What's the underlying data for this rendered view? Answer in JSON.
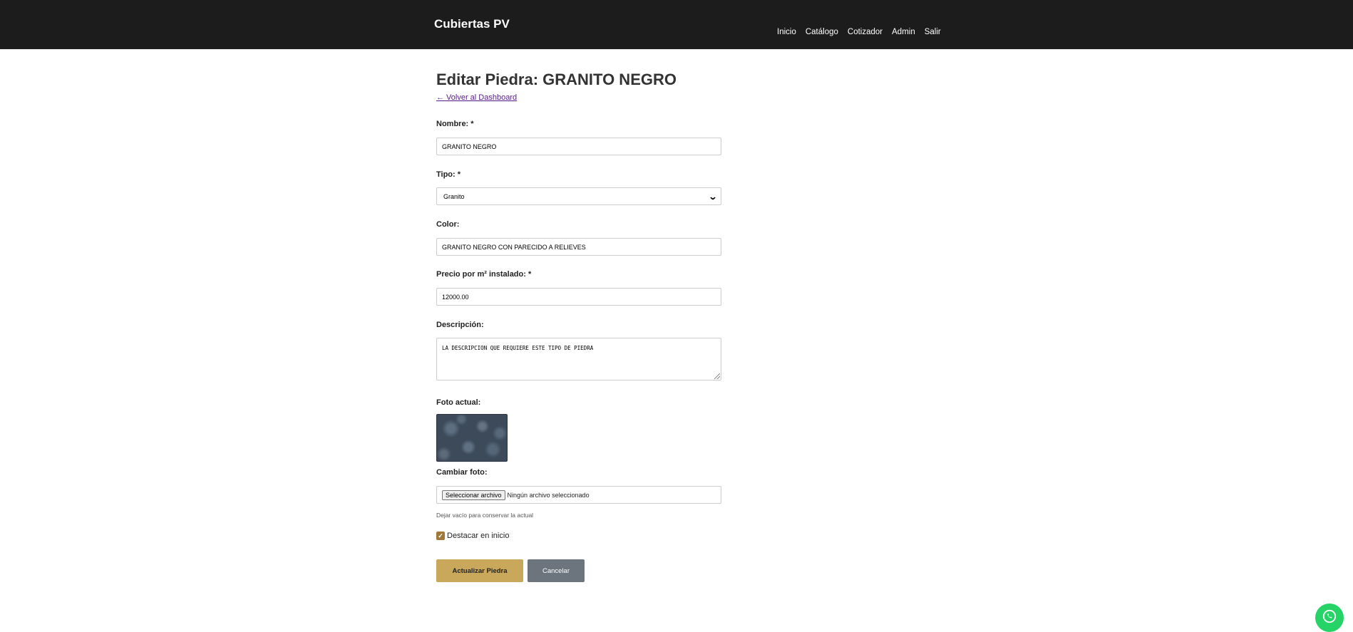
{
  "header": {
    "brand": "Cubiertas PV",
    "nav": [
      "Inicio",
      "Catálogo",
      "Cotizador",
      "Admin",
      "Salir"
    ]
  },
  "page": {
    "title": "Editar Piedra: GRANITO NEGRO",
    "back_link": "← Volver al Dashboard"
  },
  "form": {
    "nombre": {
      "label": "Nombre: *",
      "value": "GRANITO NEGRO"
    },
    "tipo": {
      "label": "Tipo: *",
      "selected": "Granito"
    },
    "color": {
      "label": "Color:",
      "value": "GRANITO NEGRO CON PARECIDO A RELIEVES"
    },
    "precio": {
      "label": "Precio por m² instalado: *",
      "value": "12000.00"
    },
    "descripcion": {
      "label": "Descripción:",
      "value": "LA DESCRIPCION QUE REQUIERE ESTE TIPO DE PIEDRA"
    },
    "foto_actual": {
      "label": "Foto actual:"
    },
    "cambiar_foto": {
      "label": "Cambiar foto:",
      "button": "Seleccionar archivo",
      "status": "Ningún archivo seleccionado",
      "hint": "Dejar vacío para conservar la actual"
    },
    "destacar": {
      "label": "Destacar en inicio",
      "checked": true
    },
    "submit": "Actualizar Piedra",
    "cancel": "Cancelar"
  },
  "colors": {
    "navbar": "#1c1c1c",
    "primary_button": "#c9a85c",
    "secondary_button": "#6c757d",
    "whatsapp": "#25d366"
  },
  "icons": {
    "select_arrow": "chevron-down-icon",
    "checkbox": "checkmark-icon",
    "floating": "whatsapp-icon"
  }
}
